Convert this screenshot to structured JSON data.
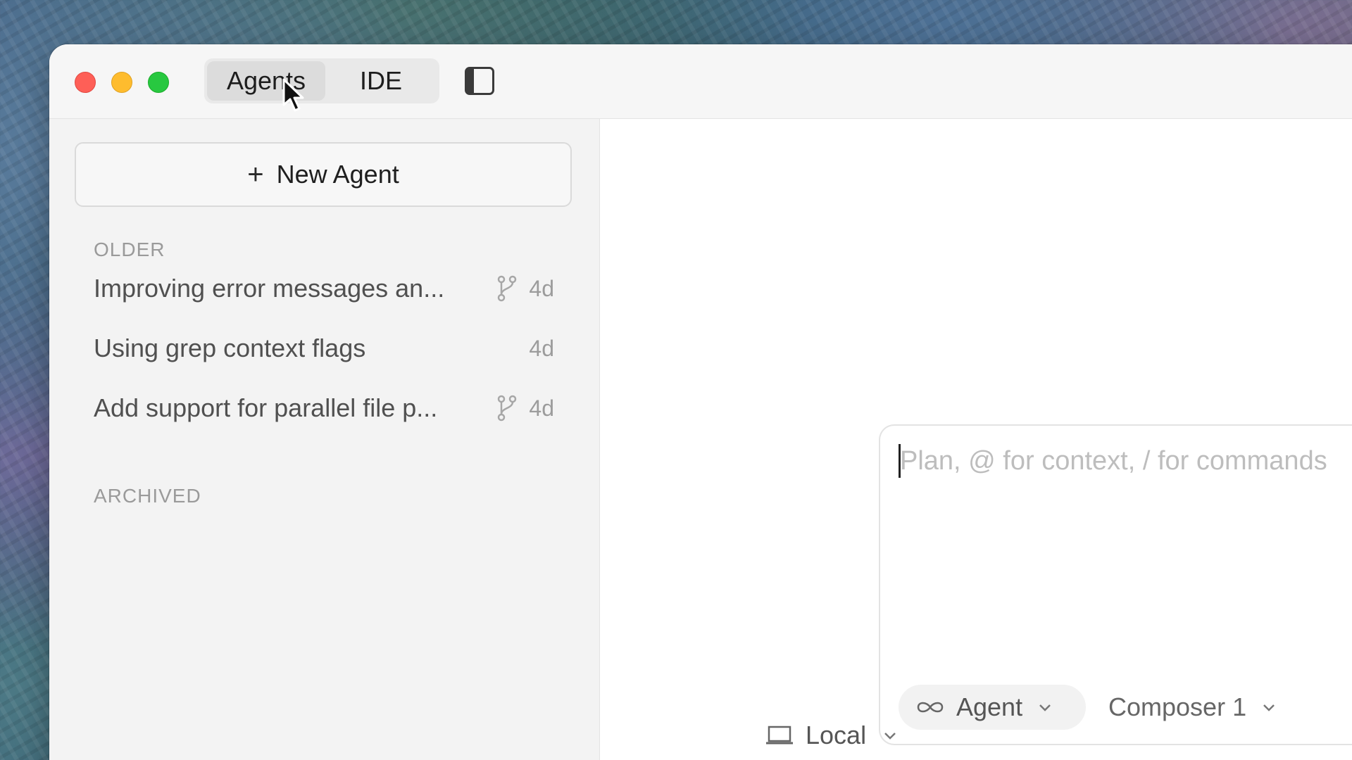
{
  "titlebar": {
    "tabs": [
      {
        "label": "Agents",
        "active": true
      },
      {
        "label": "IDE",
        "active": false
      }
    ],
    "sidebar_toggle_icon": "sidebar-icon"
  },
  "sidebar": {
    "new_agent_label": "New Agent",
    "sections": {
      "older_label": "OLDER",
      "archived_label": "ARCHIVED"
    },
    "items": [
      {
        "title": "Improving error messages an...",
        "age": "4d",
        "has_branch": true
      },
      {
        "title": "Using grep context flags",
        "age": "4d",
        "has_branch": false
      },
      {
        "title": "Add support for parallel file p...",
        "age": "4d",
        "has_branch": true
      }
    ]
  },
  "composer": {
    "placeholder": "Plan, @ for context, / for commands",
    "mode_label": "Agent",
    "model_label": "Composer 1",
    "environment_label": "Local"
  },
  "colors": {
    "close": "#fe5f57",
    "minimize": "#febc2e",
    "maximize": "#28c840"
  }
}
